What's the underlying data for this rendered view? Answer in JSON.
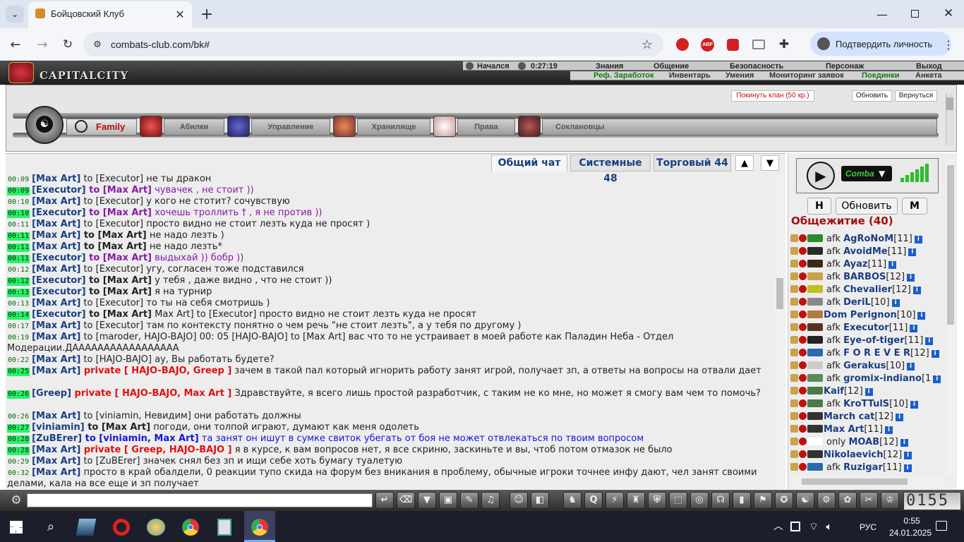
{
  "browser": {
    "tab_title": "Бойцовский Клуб",
    "url": "combats-club.com/bk#",
    "profile_label": "Подтвердить личность",
    "ext_labels": [
      "ABP"
    ]
  },
  "game": {
    "city": "CAPITALCITY",
    "battle_status": "Начался",
    "battle_time": "0:27:19",
    "top_links": [
      "Знания",
      "Общение",
      "Безопасность",
      "Персонаж",
      "Выход"
    ],
    "sub_links": [
      "Реф. Заработок",
      "Инвентарь",
      "Умения",
      "Мониторинг заявок",
      "Поединки",
      "Анкета"
    ],
    "leave_clan": "Покинуть клан (50 кр.)",
    "refresh_btn": "Обновить",
    "back_btn": "Вернуться",
    "clan_menu": [
      "Family",
      "Абилки",
      "Управление",
      "Хранилище",
      "Права",
      "Соклановцы"
    ]
  },
  "chat": {
    "tabs": [
      "Общий чат",
      "Системные 48",
      "Торговый 44"
    ],
    "scroll_up": "▲",
    "scroll_down": "▼",
    "messages": [
      {
        "time": "00:09",
        "hl": false,
        "a": "[Max Art]",
        "b": " to [Executor]",
        "c": " не ты дракон",
        "bold_b": false,
        "cls": ""
      },
      {
        "time": "00:09",
        "hl": true,
        "a": "[Executor]",
        "b": " to [Max Art]",
        "c": " чувачек , не стоит ))",
        "bold_b": true,
        "cls": "purple"
      },
      {
        "time": "00:10",
        "hl": false,
        "a": "[Max Art]",
        "b": " to [Executor]",
        "c": " у кого не стотит? сочувствую",
        "bold_b": false,
        "cls": ""
      },
      {
        "time": "00:10",
        "hl": true,
        "a": "[Executor]",
        "b": " to [Max Art]",
        "c": " хочешь троллить † , я не против ))",
        "bold_b": true,
        "cls": "purple"
      },
      {
        "time": "00:11",
        "hl": false,
        "a": "[Max Art]",
        "b": " to [Executor]",
        "c": " просто видно не стоит лезть куда не просят )",
        "bold_b": false,
        "cls": ""
      },
      {
        "time": "00:11",
        "hl": true,
        "a": "[Max Art]",
        "b": " to [Max Art]",
        "c": " не надо лезть )",
        "bold_b": true,
        "cls": ""
      },
      {
        "time": "00:11",
        "hl": true,
        "a": "[Max Art]",
        "b": " to [Max Art]",
        "c": " не надо лезть*",
        "bold_b": true,
        "cls": ""
      },
      {
        "time": "00:11",
        "hl": true,
        "a": "[Executor]",
        "b": " to [Max Art]",
        "c": " выдыхай )) бобр ))",
        "bold_b": true,
        "cls": "purple"
      },
      {
        "time": "00:12",
        "hl": false,
        "a": "[Max Art]",
        "b": " to [Executor]",
        "c": " угу, согласен тоже подставился",
        "bold_b": false,
        "cls": ""
      },
      {
        "time": "00:12",
        "hl": true,
        "a": "[Executor]",
        "b": " to [Max Art]",
        "c": " у тебя , даже видно , что не стоит ))",
        "bold_b": true,
        "cls": ""
      },
      {
        "time": "00:13",
        "hl": true,
        "a": "[Executor]",
        "b": " to [Max Art]",
        "c": " я на турнир",
        "bold_b": true,
        "cls": ""
      },
      {
        "time": "00:13",
        "hl": false,
        "a": "[Max Art]",
        "b": " to [Executor]",
        "c": " то ты на себя смотришь )",
        "bold_b": false,
        "cls": ""
      },
      {
        "time": "00:14",
        "hl": true,
        "a": "[Executor]",
        "b": " to [Max Art]",
        "c": " Max Art] to [Executor] просто видно не стоит лезть куда не просят",
        "bold_b": true,
        "cls": ""
      },
      {
        "time": "00:17",
        "hl": false,
        "a": "[Max Art]",
        "b": " to [Executor]",
        "c": " там по контексту понятно о чем речь \"не стоит лезть\", а у тебя по другому )",
        "bold_b": false,
        "cls": ""
      },
      {
        "time": "00:19",
        "hl": false,
        "a": "[Max Art]",
        "b": " to [maroder, HAJO-BAJO]",
        "c": " 00: 05 [HAJO-BAJO] to [Max Art] вас что то не устраивает в моей работе как Паладин Неба - Отдел Модерации.ДААААААААААААААААА",
        "bold_b": false,
        "cls": "",
        "wrap": true
      },
      {
        "time": "00:22",
        "hl": false,
        "a": "[Max Art]",
        "b": " to [HAJO-BAJO]",
        "c": " ау, Вы работать будете?",
        "bold_b": false,
        "cls": ""
      },
      {
        "time": "00:25",
        "hl": true,
        "a": "[Max Art]",
        "b": " private [ HAJO-BAJO, Greep ]",
        "c": " зачем в такой пал который игнорить работу занят игрой, получает зп, а ответы на вопросы на отвали дает",
        "bold_b": false,
        "cls": "",
        "priv": true,
        "wrap": true
      },
      {
        "time": "00:26",
        "hl": true,
        "a": "[Greep]",
        "b": " private [ HAJO-BAJO, Max Art ]",
        "c": " Здравствуйте, я всего лишь простой разработчик, с таким не ко мне, но может я смогу вам чем то помочь?",
        "bold_b": false,
        "cls": "",
        "priv": true,
        "wrap": true
      },
      {
        "time": "00:26",
        "hl": false,
        "a": "[Max Art]",
        "b": " to [viniamin, Невидим]",
        "c": " они работать должны",
        "bold_b": false,
        "cls": ""
      },
      {
        "time": "00:27",
        "hl": true,
        "a": "[viniamin]",
        "b": " to [Max Art]",
        "c": " погоди, они толпой играют, думают как меня одолеть",
        "bold_b": true,
        "cls": ""
      },
      {
        "time": "00:28",
        "hl": true,
        "a": "[ZuBErer]",
        "b": " to [viniamin, Max Art]",
        "c": " та занят он ишут в сумке свиток убегать от боя не может отвлекаться по твоим вопросом",
        "bold_b": true,
        "cls": "blue",
        "bluetarget": true
      },
      {
        "time": "00:28",
        "hl": true,
        "a": "[Max Art]",
        "b": " private [ Greep, HAJO-BAJO ]",
        "c": " я в курсе, к вам вопросов нет, я все скриню, заскиньте и вы, чтоб потом отмазок не было",
        "bold_b": false,
        "cls": "",
        "priv": true
      },
      {
        "time": "00:29",
        "hl": false,
        "a": "[Max Art]",
        "b": " to [ZuBErer]",
        "c": " значек снял без зп и ищи себе хоть бумагу туалетую",
        "bold_b": false,
        "cls": ""
      },
      {
        "time": "00:32",
        "hl": false,
        "a": "[Max Art]",
        "b": "",
        "c": " просто в край обалдели, 0 реакции тупо скида на форум без вникания в проблему, обычные игроки точнее инфу дают, чел занят своими делами, кала на все еще и зп получает",
        "bold_b": false,
        "cls": "",
        "wrap": true
      }
    ]
  },
  "side": {
    "player_btn_n": "Н",
    "player_btn_refresh": "Обновить",
    "player_btn_m": "М",
    "player_brand": "Comba",
    "room_title": "Общежитие (40)",
    "users": [
      {
        "afk": "afk",
        "name": "AgRoNoM",
        "lvl": "[11]",
        "c": "#2b8a2b"
      },
      {
        "afk": "afk",
        "name": "AvoidMe",
        "lvl": "[11]",
        "c": "#2a2a2a"
      },
      {
        "afk": "afk",
        "name": "Ayaz",
        "lvl": "[11]",
        "c": "#3a2a1a"
      },
      {
        "afk": "afk",
        "name": "BARBOS",
        "lvl": "[12]",
        "c": "#c9a34a"
      },
      {
        "afk": "afk",
        "name": "Chevalier",
        "lvl": "[12]",
        "c": "#c0c020"
      },
      {
        "afk": "afk",
        "name": "DeriL",
        "lvl": "[10]",
        "c": "#888"
      },
      {
        "afk": "",
        "name": "Dom Perignon",
        "lvl": "[10]",
        "c": "#b07a40"
      },
      {
        "afk": "afk",
        "name": "Executor",
        "lvl": "[11]",
        "c": "#553322"
      },
      {
        "afk": "afk",
        "name": "Eye-of-tiger",
        "lvl": "[11]",
        "c": "#222"
      },
      {
        "afk": "afk",
        "name": "F O R E V E R",
        "lvl": "[12]",
        "c": "#2a6ab0"
      },
      {
        "afk": "afk",
        "name": "Gerakus",
        "lvl": "[10]",
        "c": "#ccc"
      },
      {
        "afk": "afk",
        "name": "gromix-indiano",
        "lvl": "[1",
        "c": "#5a8a5a"
      },
      {
        "afk": "",
        "name": "Kaif",
        "lvl": "[12]",
        "c": "#4a7a4a"
      },
      {
        "afk": "afk",
        "name": "KroTTulS",
        "lvl": "[10]",
        "c": "#4a7a4a"
      },
      {
        "afk": "",
        "name": "March cat",
        "lvl": "[12]",
        "c": "#333"
      },
      {
        "afk": "",
        "name": "Max Art",
        "lvl": "[11]",
        "c": "#333"
      },
      {
        "afk": "only",
        "name": "MOAB",
        "lvl": "[12]",
        "c": "#fff"
      },
      {
        "afk": "",
        "name": "Nikolaevich",
        "lvl": "[12]",
        "c": "#333"
      },
      {
        "afk": "afk",
        "name": "Ruzigar",
        "lvl": "[11]",
        "c": "#2a6ab0"
      }
    ]
  },
  "clock": "0155",
  "taskbar": {
    "lang": "РУС",
    "time": "0:55",
    "date": "24.01.2025"
  }
}
